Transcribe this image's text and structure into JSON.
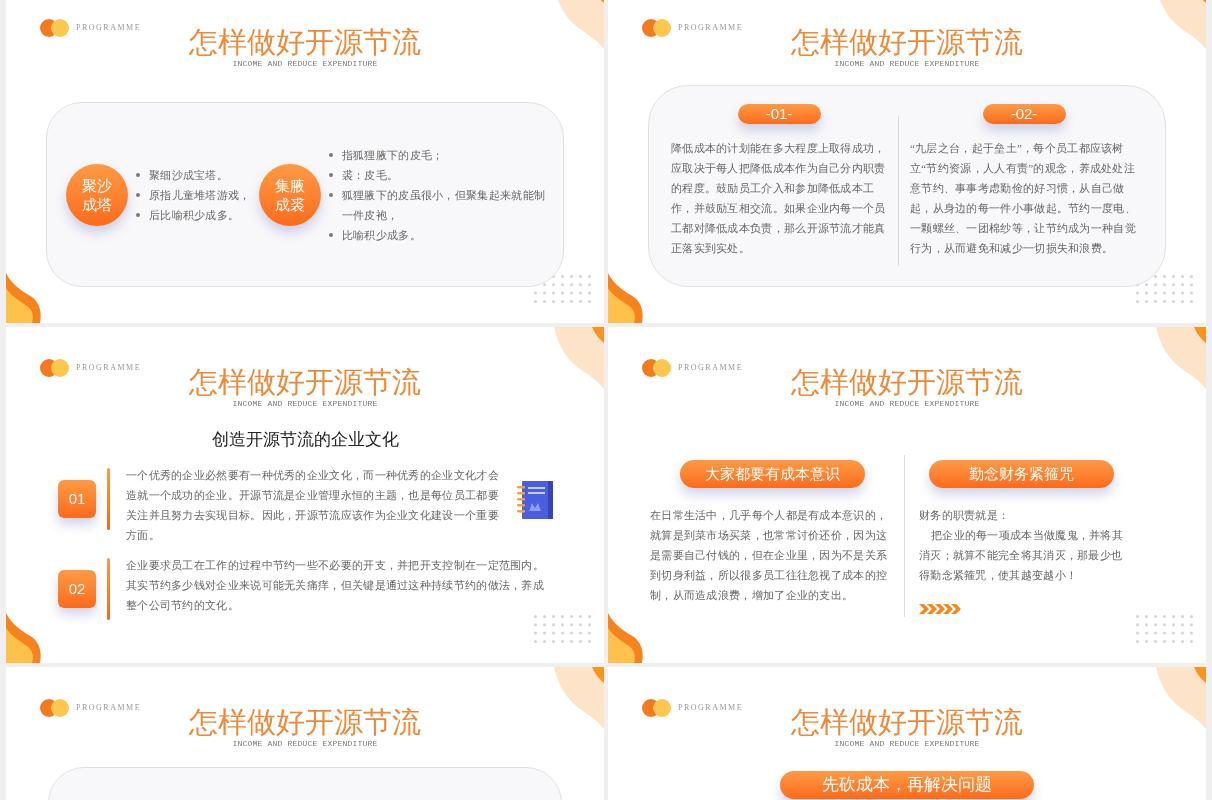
{
  "slides": [
    {
      "kind": "bullets",
      "header": {
        "tag": "PROGRAMME",
        "title": "怎样做好开源节流",
        "subtitle": "INCOME AND REDUCE EXPENDITURE"
      },
      "groups": [
        {
          "label": "聚沙成塔",
          "points": [
            "聚细沙成宝塔。",
            "原指儿童堆塔游戏，",
            "后比喻积少成多。"
          ]
        },
        {
          "label": "集腋成裘",
          "points": [
            "指狐狸腋下的皮毛；",
            "裘：皮毛。",
            "狐狸腋下的皮虽很小，但聚集起来就能制一件皮袍，",
            "比喻积少成多。"
          ]
        }
      ]
    },
    {
      "kind": "columns",
      "header": {
        "tag": "PROGRAMME",
        "title": "怎样做好开源节流",
        "subtitle": "INCOME AND REDUCE EXPENDITURE"
      },
      "columns": [
        {
          "label": "-01-",
          "text": "降低成本的计划能在多大程度上取得成功，应取决于每人把降低成本作为自己分内职责的程度。鼓励员工介入和参加降低成本工作，并鼓励互相交流。如果企业内每一个员工都对降低成本负责，那么开源节流才能真正落实到实处。"
        },
        {
          "label": "-02-",
          "text": "“九层之台，起于垒土”，每个员工都应该树立“节约资源，人人有责”的观念，养成处处注意节约、事事考虑勤俭的好习惯，从自己做起，从身边的每一件小事做起。节约一度电、一颗螺丝、一团棉纱等，让节约成为一种自觉行为，从而避免和减少一切损失和浪费。"
        }
      ]
    },
    {
      "kind": "numbered",
      "header": {
        "tag": "PROGRAMME",
        "title": "怎样做好开源节流",
        "subtitle": "INCOME AND REDUCE EXPENDITURE"
      },
      "heading": "创造开源节流的企业文化",
      "items": [
        {
          "number": "01",
          "text": "一个优秀的企业必然要有一种优秀的企业文化，而一种优秀的企业文化才会造就一个成功的企业。开源节流是企业管理永恒的主题，也是每位员工都要关注并且努力去实现目标。因此，开源节流应该作为企业文化建设一个重要方面。"
        },
        {
          "number": "02",
          "text": "企业要求员工在工作的过程中节约一些不必要的开支，并把开支控制在一定范围内。其实节约多少钱对企业来说可能无关痛痒，但关键是通过这种持续节约的做法，养成整个公司节约的文化。"
        }
      ]
    },
    {
      "kind": "split",
      "header": {
        "tag": "PROGRAMME",
        "title": "怎样做好开源节流",
        "subtitle": "INCOME AND REDUCE EXPENDITURE"
      },
      "columns": [
        {
          "label": "大家都要有成本意识",
          "paragraphs": [
            "在日常生活中，几乎每个人都是有成本意识的，就算是到菜市场买菜，也常常讨价还价，因为这是需要自己付钱的，但在企业里，因为不是关系到切身利益，所以很多员工往往忽视了成本的控制，从而造成浪费，增加了企业的支出。"
          ]
        },
        {
          "label": "勤念财务紧箍咒",
          "paragraphs": [
            "财务的职责就是：",
            "把企业的每一项成本当做魔鬼，并将其消灭；就算不能完全将其消灭，那最少也得勤念紧箍咒，使其越变越小！"
          ]
        }
      ]
    },
    {
      "kind": "card",
      "header": {
        "tag": "PROGRAMME",
        "title": "怎样做好开源节流",
        "subtitle": "INCOME AND REDUCE EXPENDITURE"
      }
    },
    {
      "kind": "banner",
      "header": {
        "tag": "PROGRAMME",
        "title": "怎样做好开源节流",
        "subtitle": "INCOME AND REDUCE EXPENDITURE"
      },
      "label": "先砍成本，再解决问题"
    }
  ]
}
